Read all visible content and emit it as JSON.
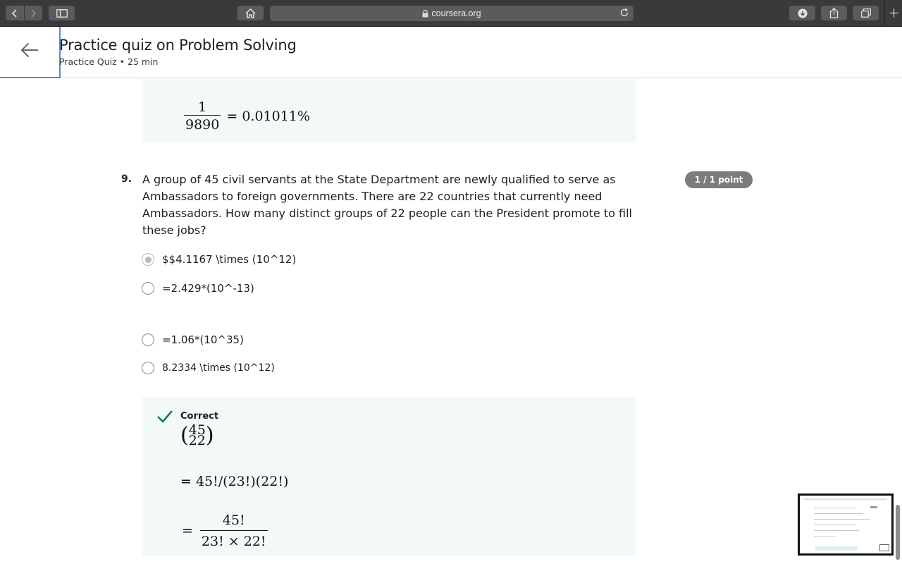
{
  "browser": {
    "url": "coursera.org"
  },
  "header": {
    "title": "Practice quiz on Problem Solving",
    "subtitle": "Practice Quiz • 25 min"
  },
  "prev_feedback": {
    "numerator": "1",
    "denominator": "9890",
    "result": "= 0.01011%"
  },
  "question": {
    "number": "9.",
    "text": "A group of 45 civil servants at the State Department are newly qualified to serve as Ambassadors to foreign governments. There are 22 countries that currently need Ambassadors. How many distinct groups of 22 people can the President promote to fill these jobs?",
    "score": "1 / 1 point",
    "options": [
      {
        "label": "$$4.1167 \\times (10^12)",
        "selected": true
      },
      {
        "label": "=2.429*(10^-13)",
        "selected": false
      },
      {
        "label": "=1.06*(10^35)",
        "selected": false
      },
      {
        "label": "8.2334 \\times (10^12)",
        "selected": false
      }
    ]
  },
  "feedback": {
    "label": "Correct",
    "binom_top": "45",
    "binom_bottom": "22",
    "line2": "= 45!/(23!)(22!)",
    "eq": "=",
    "frac_num": "45!",
    "frac_den": "23! × 22!"
  },
  "colors": {
    "accent": "#0f7a5f",
    "panel": "#f2f9f7",
    "badge": "#7c7c7c"
  }
}
